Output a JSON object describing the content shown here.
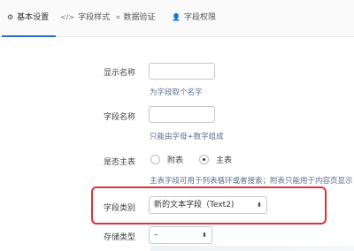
{
  "tabs": [
    {
      "icon": "⚙",
      "icon_name": "gear-icon",
      "label": "基本设置",
      "active": true
    },
    {
      "icon": "</>",
      "icon_name": "code-icon",
      "label": "字段样式",
      "active": false
    },
    {
      "icon": "⌗",
      "icon_name": "crop-icon",
      "label": "数据验证",
      "active": false
    },
    {
      "icon": "👤",
      "icon_name": "user-icon",
      "label": "字段权限",
      "active": false
    }
  ],
  "form": {
    "display_name": {
      "label": "显示名称",
      "value": "",
      "help": "为字段取个名字"
    },
    "field_name": {
      "label": "字段名称",
      "value": "",
      "help": "只能由字母+数字组成"
    },
    "is_main": {
      "label": "是否主表",
      "options": [
        "附表",
        "主表"
      ],
      "selected": "主表",
      "help": "主表字段可用于列表循环或者搜索；附表只能用于内容页显示"
    },
    "field_type": {
      "label": "字段类别",
      "value": "新的文本字段（Text2)"
    },
    "storage_type": {
      "label": "存储类型",
      "value": "–"
    }
  },
  "colors": {
    "accent": "#2b6cc4",
    "highlight_border": "#e0303c"
  }
}
